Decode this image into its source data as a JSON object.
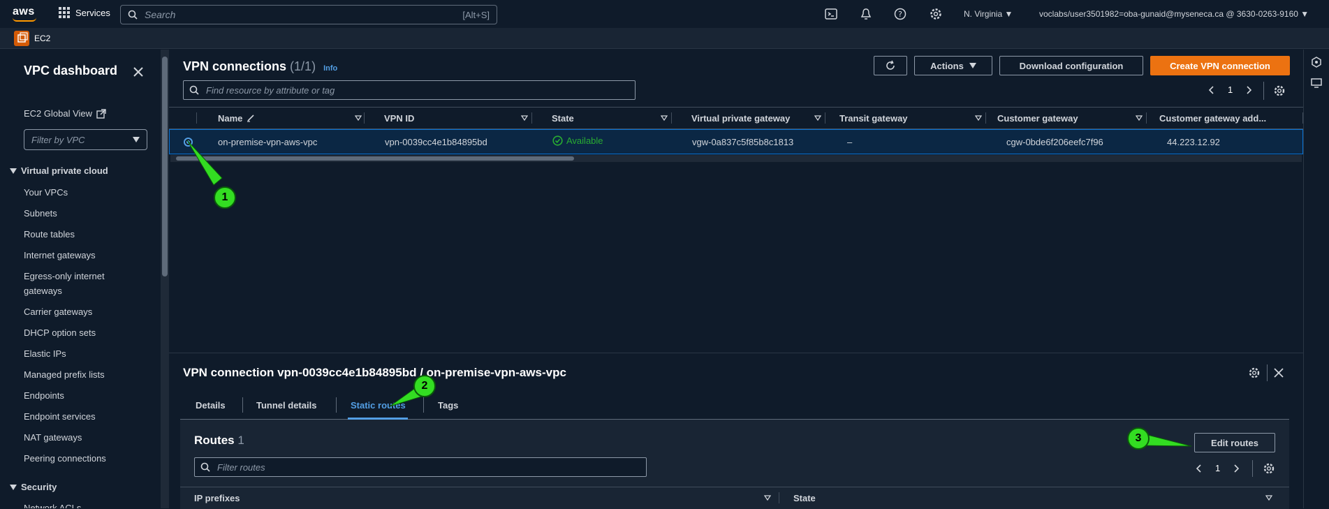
{
  "topnav": {
    "logo": "aws",
    "services_label": "Services",
    "search_placeholder": "Search",
    "search_shortcut": "[Alt+S]",
    "region": "N. Virginia",
    "account": "voclabs/user3501982=oba-gunaid@myseneca.ca @ 3630-0263-9160",
    "icons": [
      "cloudshell-icon",
      "bell-icon",
      "help-icon",
      "settings-icon"
    ]
  },
  "subnav": {
    "service": "EC2"
  },
  "sidebar": {
    "title": "VPC dashboard",
    "global_view": "EC2 Global View",
    "filter_placeholder": "Filter by VPC",
    "section_vpc": "Virtual private cloud",
    "items": [
      "Your VPCs",
      "Subnets",
      "Route tables",
      "Internet gateways",
      "Egress-only internet gateways",
      "Carrier gateways",
      "DHCP option sets",
      "Elastic IPs",
      "Managed prefix lists",
      "Endpoints",
      "Endpoint services",
      "NAT gateways",
      "Peering connections"
    ],
    "section_security": "Security",
    "security_items": [
      "Network ACLs"
    ]
  },
  "main": {
    "title": "VPN connections",
    "count": "(1/1)",
    "info": "Info",
    "buttons": {
      "actions": "Actions",
      "download": "Download configuration",
      "create": "Create VPN connection"
    },
    "search_placeholder": "Find resource by attribute or tag",
    "page": "1",
    "columns": [
      "Name",
      "VPN ID",
      "State",
      "Virtual private gateway",
      "Transit gateway",
      "Customer gateway",
      "Customer gateway add..."
    ],
    "row": {
      "name": "on-premise-vpn-aws-vpc",
      "vpn_id": "vpn-0039cc4e1b84895bd",
      "state": "Available",
      "vgw": "vgw-0a837c5f85b8c1813",
      "tgw": "–",
      "cgw": "cgw-0bde6f206eefc7f96",
      "cgw_address": "44.223.12.92"
    }
  },
  "detail": {
    "title": "VPN connection vpn-0039cc4e1b84895bd / on-premise-vpn-aws-vpc",
    "tabs": [
      "Details",
      "Tunnel details",
      "Static routes",
      "Tags"
    ],
    "active_tab": "Static routes",
    "routes_title": "Routes",
    "routes_count": "1",
    "edit_routes": "Edit routes",
    "routes_search_placeholder": "Filter routes",
    "routes_page": "1",
    "routes_columns": [
      "IP prefixes",
      "State"
    ]
  },
  "annotations": [
    "1",
    "2",
    "3"
  ],
  "colors": {
    "accent": "#ec7211",
    "link": "#539fe5",
    "success": "#29ad32",
    "annotation": "#33dd22"
  }
}
